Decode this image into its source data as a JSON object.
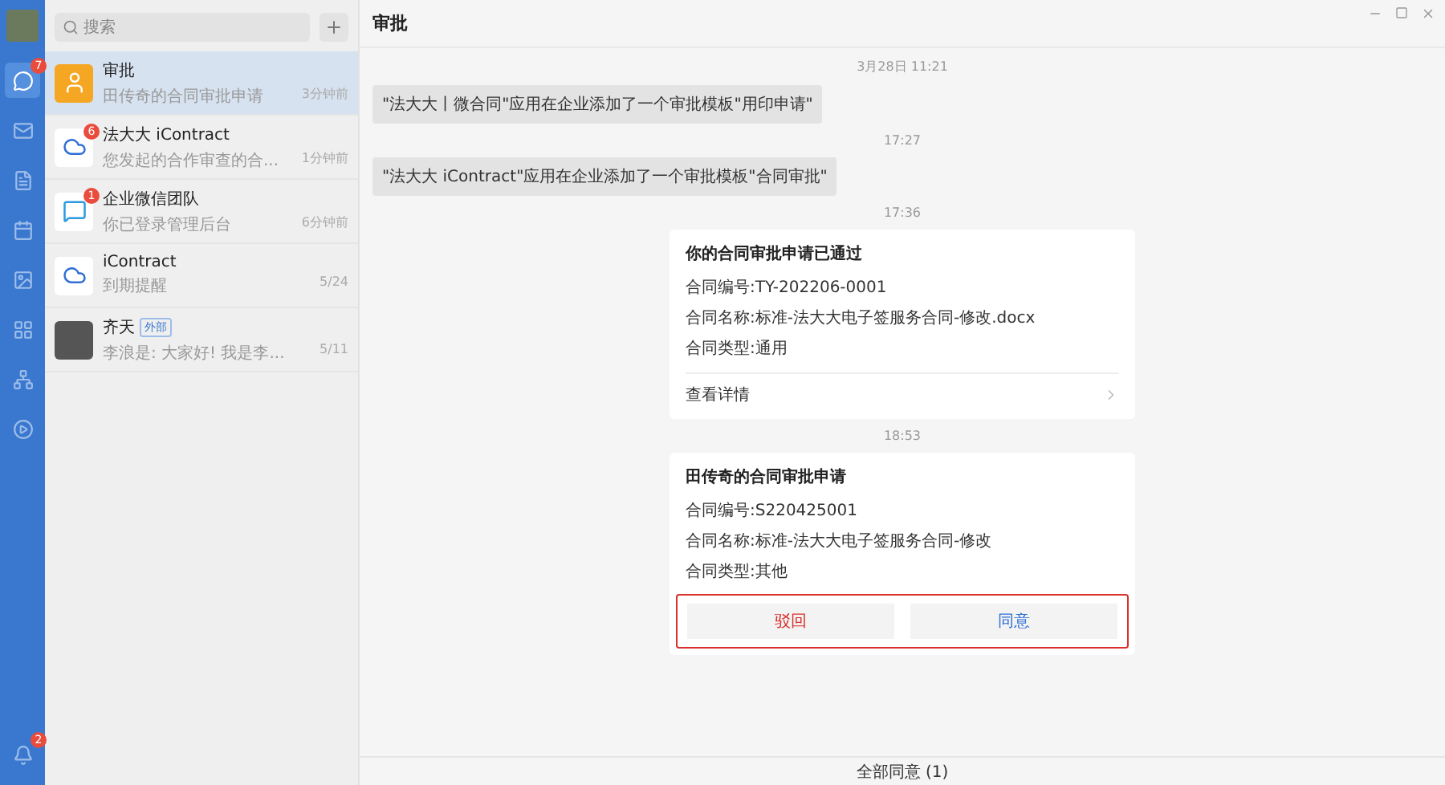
{
  "rail": {
    "items": [
      {
        "selected": true,
        "badge": "7"
      },
      {
        "selected": false
      },
      {
        "selected": false
      },
      {
        "selected": false
      },
      {
        "selected": false
      },
      {
        "selected": false
      },
      {
        "selected": false
      },
      {
        "selected": false
      }
    ],
    "bottom_badge": "2"
  },
  "sidebar": {
    "search": {
      "placeholder": "搜索"
    },
    "conversations": [
      {
        "kind": "approval",
        "name": "审批",
        "preview": "田传奇的合同审批申请",
        "time": "3分钟前",
        "selected": true
      },
      {
        "kind": "cloud",
        "name": "法大大 iContract",
        "preview": "您发起的合作审查的合...",
        "time": "1分钟前",
        "badge": "6",
        "selected": false
      },
      {
        "kind": "chat",
        "name": "企业微信团队",
        "preview": "你已登录管理后台",
        "time": "6分钟前",
        "badge": "1",
        "selected": false
      },
      {
        "kind": "cloud",
        "name": "iContract",
        "preview": "到期提醒",
        "time": "5/24",
        "selected": false
      },
      {
        "kind": "photo",
        "name": "齐天",
        "tag": "外部",
        "preview": "李浪是: 大家好! 我是李...",
        "time": "5/11",
        "selected": false
      }
    ]
  },
  "chat": {
    "title": "审批",
    "messages": [
      {
        "kind": "time",
        "text": "3月28日 11:21"
      },
      {
        "kind": "system",
        "text": "\"法大大丨微合同\"应用在企业添加了一个审批模板\"用印申请\""
      },
      {
        "kind": "time",
        "text": "17:27"
      },
      {
        "kind": "system",
        "text": "\"法大大 iContract\"应用在企业添加了一个审批模板\"合同审批\""
      },
      {
        "kind": "time",
        "text": "17:36"
      },
      {
        "kind": "card",
        "title": "你的合同审批申请已通过",
        "lines": [
          "合同编号:TY-202206-0001",
          "合同名称:标准-法大大电子签服务合同-修改.docx",
          "合同类型:通用"
        ],
        "link": "查看详情"
      },
      {
        "kind": "time",
        "text": "18:53"
      },
      {
        "kind": "card",
        "title": "田传奇的合同审批申请",
        "lines": [
          "合同编号:S220425001",
          "合同名称:标准-法大大电子签服务合同-修改",
          "合同类型:其他"
        ],
        "highlighted": true,
        "actions": [
          {
            "kind": "reject",
            "label": "驳回"
          },
          {
            "kind": "approve",
            "label": "同意"
          }
        ]
      }
    ],
    "footer": "全部同意 (1)"
  }
}
